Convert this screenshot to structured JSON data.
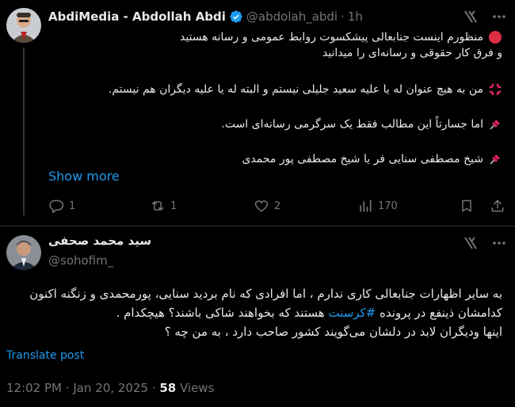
{
  "reply_tweet": {
    "display_name": "AbdiMedia - Abdollah Abdi",
    "handle": "@abdolah_abdi",
    "separator": "·",
    "time_ago": "1h",
    "lines": [
      "منظورم اینست جنابعالی پیشکسوت روابط عمومی و رسانه هستید",
      "و فرق کار حقوقی و رسانه‌ای را میدانید",
      "من به هیچ عنوان له یا علیه سعید جلیلی نیستم و البته له یا علیه دیگران هم نیستم.",
      "اما جسارتاً این مطالب فقط یک سرگرمی رسانه‌ای است.",
      "شیخ مصطفی سنایی فر یا شیخ مصطفی پور محمدی"
    ],
    "show_more": "Show more",
    "actions": {
      "replies": "1",
      "reposts": "1",
      "likes": "2",
      "views": "170"
    }
  },
  "main_tweet": {
    "display_name": "سید محمد صحفی",
    "handle": "@sohofim_",
    "line1": "به سایر اظهارات جنابعالی کاری ندارم ، اما افرادی که نام بردید سنایی، پورمحمدی و زنگنه اکنون",
    "line2_a": "کدامشان ذینفع در پرونده",
    "line2_hashtag": "#کرسنت",
    "line2_b": "هستند که بخواهند شاکی باشند؟ هیچکدام .",
    "line3": "اینها ودیگران لابد در دلشان می‌گویند کشور صاحب دارد ، به من چه ؟",
    "translate": "Translate post",
    "time": "12:02 PM",
    "date": "Jan 20, 2025",
    "views_count": "58",
    "views_label": "Views"
  },
  "colors": {
    "background": "#000000",
    "text": "#e7e9ea",
    "muted": "#71767b",
    "accent": "#1d9bf0",
    "divider": "#2f3336",
    "red_circle": "#dd2e44",
    "pin": "#e0245e"
  },
  "icons": [
    "verified-badge-icon",
    "grok-icon",
    "more-icon",
    "red-circle-icon",
    "anger-icon",
    "pushpin-icon",
    "reply-icon",
    "repost-icon",
    "like-icon",
    "views-icon",
    "bookmark-icon",
    "share-icon"
  ]
}
